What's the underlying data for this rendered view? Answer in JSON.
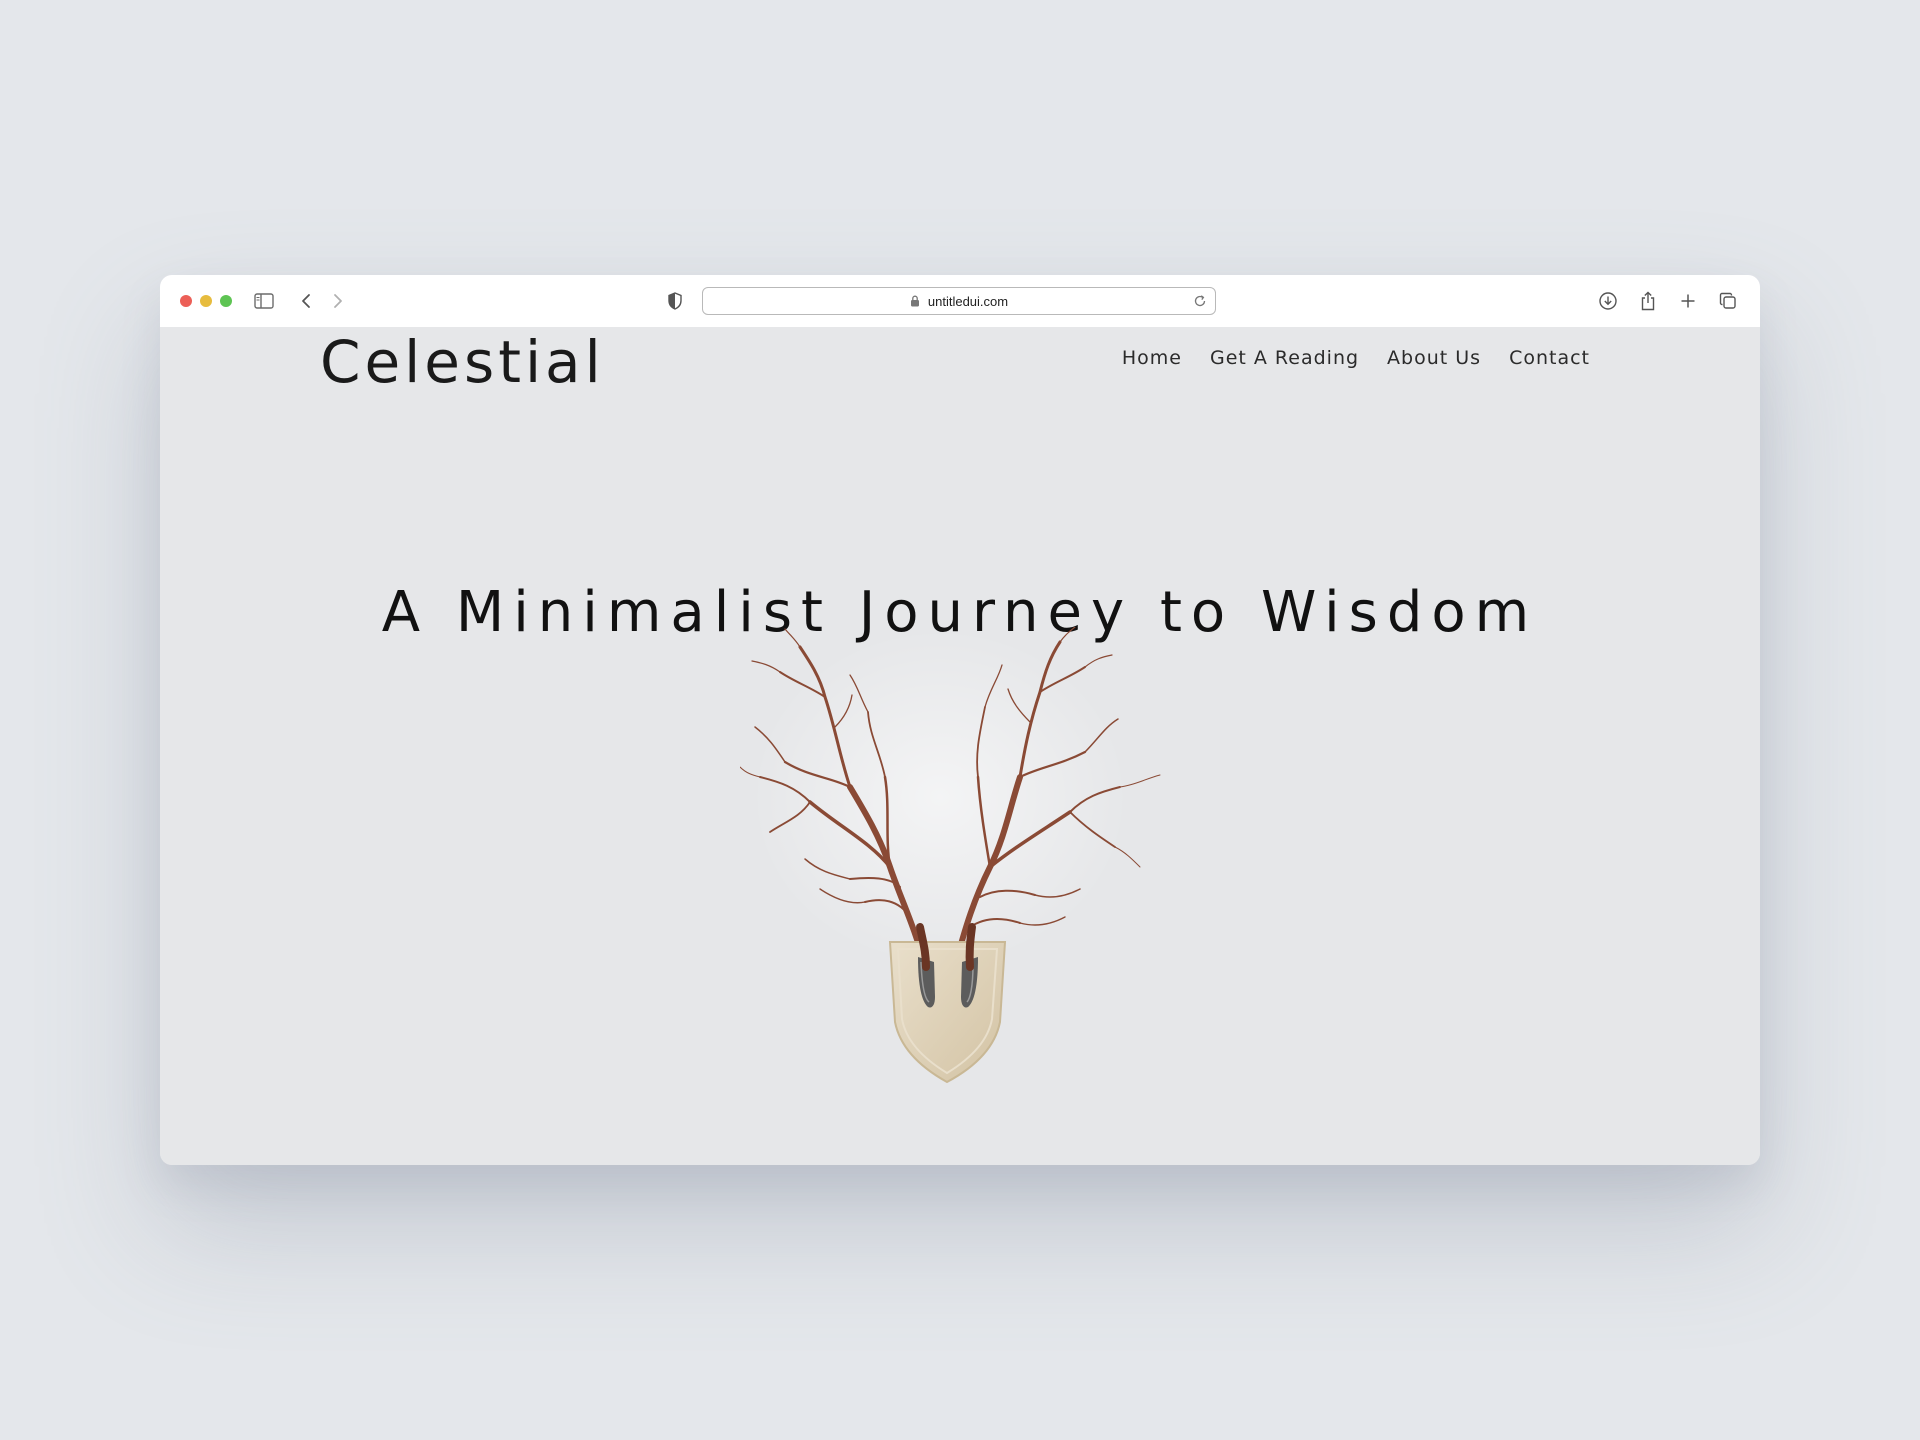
{
  "browser": {
    "url": "untitledui.com"
  },
  "site": {
    "logo": "Celestial",
    "nav": [
      {
        "label": "Home"
      },
      {
        "label": "Get A Reading"
      },
      {
        "label": "About Us"
      },
      {
        "label": "Contact"
      }
    ]
  },
  "hero": {
    "title": "A Minimalist Journey to Wisdom",
    "image_alt": "Branches mounted on a wooden shield like antlers"
  },
  "colors": {
    "background": "#e4e7eb",
    "page": "#e6e7e9",
    "text": "#111111",
    "branch": "#8a4a35",
    "shield": "#ddd0b8"
  }
}
